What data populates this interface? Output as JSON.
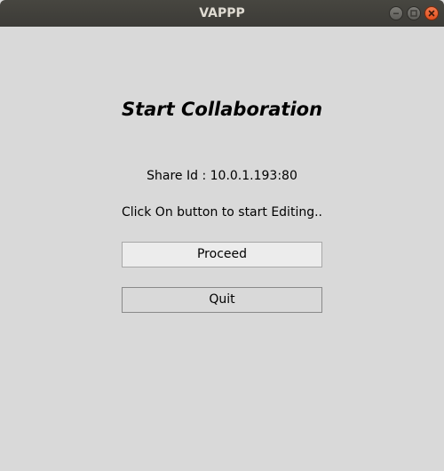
{
  "window": {
    "title": "VAPPP"
  },
  "titlebar_buttons": {
    "minimize": "minimize-icon",
    "maximize": "maximize-icon",
    "close": "close-icon"
  },
  "main": {
    "heading": "Start Collaboration",
    "share_id": "Share Id : 10.0.1.193:80",
    "instruction": "Click On button to start Editing..",
    "proceed_label": "Proceed",
    "quit_label": "Quit"
  },
  "colors": {
    "titlebar": "#3c3b37",
    "background": "#d9d9d9",
    "close_button": "#e95420"
  }
}
